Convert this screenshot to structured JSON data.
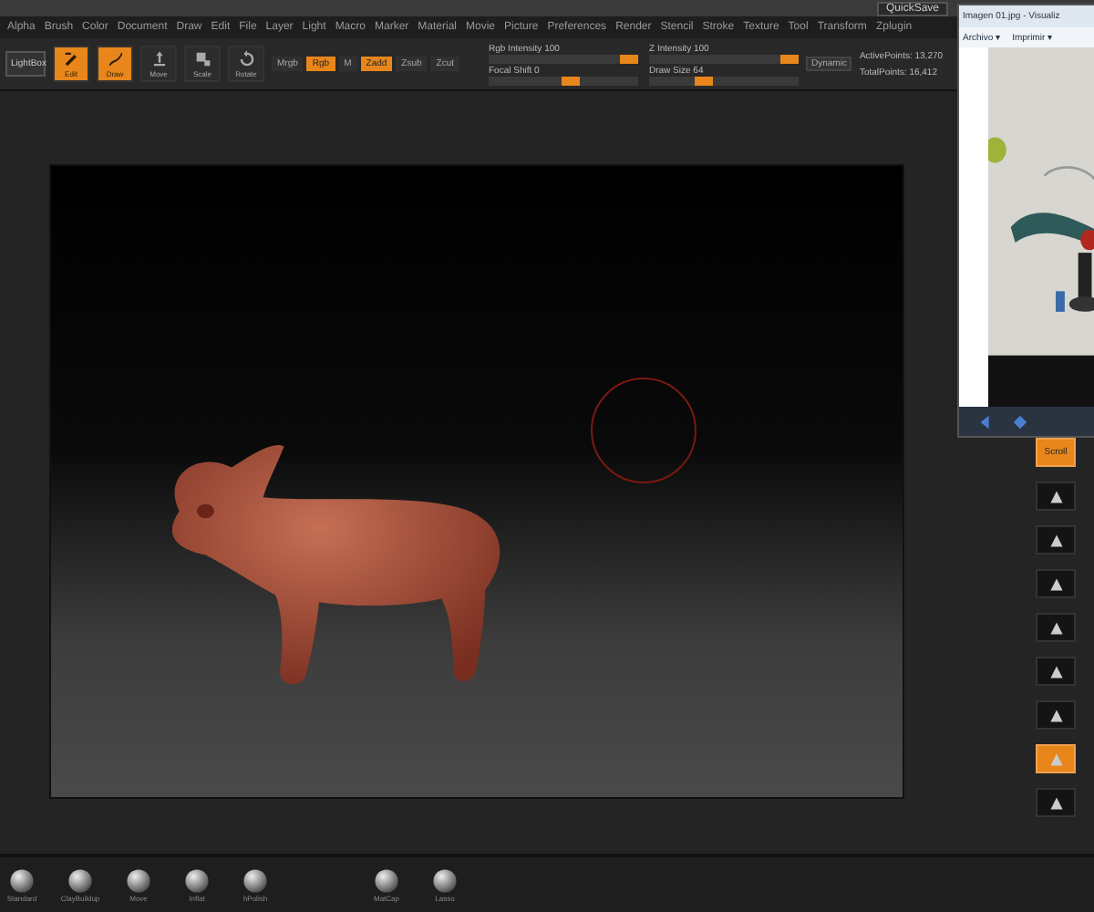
{
  "menu": [
    "Alpha",
    "Brush",
    "Color",
    "Document",
    "Draw",
    "Edit",
    "File",
    "Layer",
    "Light",
    "Macro",
    "Marker",
    "Material",
    "Movie",
    "Picture",
    "Preferences",
    "Render",
    "Stencil",
    "Stroke",
    "Texture",
    "Tool",
    "Transform",
    "Zplugin"
  ],
  "quicksave": "QuickSave",
  "toolbar": {
    "lightbox": "LightBox",
    "tools": [
      {
        "kind": "edit",
        "label": "Edit",
        "selected": true
      },
      {
        "kind": "draw",
        "label": "Draw",
        "selected": true
      },
      {
        "kind": "move",
        "label": "Move",
        "selected": false
      },
      {
        "kind": "scale",
        "label": "Scale",
        "selected": false
      },
      {
        "kind": "rotate",
        "label": "Rotate",
        "selected": false
      }
    ],
    "modes": [
      {
        "label": "Mrgb",
        "selected": false
      },
      {
        "label": "Rgb",
        "selected": true
      },
      {
        "label": "M",
        "selected": false
      },
      {
        "label": "Zadd",
        "selected": true
      },
      {
        "label": "Zsub",
        "selected": false
      },
      {
        "label": "Zcut",
        "selected": false
      }
    ],
    "sliders": [
      {
        "label": "Rgb Intensity 100",
        "level": 1
      },
      {
        "label": "Z Intensity 100",
        "level": 1
      },
      {
        "label": "Focal Shift 0",
        "level": 0.55
      },
      {
        "label": "Draw Size 64",
        "level": 0.35
      }
    ],
    "dynamic": "Dynamic",
    "stats": [
      "ActivePoints: 13,270",
      "TotalPoints: 16,412"
    ]
  },
  "viewer": {
    "title": "Imagen 01.jpg - Visualiz",
    "menu": [
      "Archivo ▾",
      "Imprimir ▾"
    ]
  },
  "shelf": [
    {
      "label": "Scroll",
      "selected": true
    },
    {
      "selected": false
    },
    {
      "selected": false
    },
    {
      "selected": false
    },
    {
      "selected": false
    },
    {
      "selected": false
    },
    {
      "selected": false
    },
    {
      "selected": true
    },
    {
      "selected": false
    }
  ],
  "brushes": [
    "Standard",
    "ClayBuildup",
    "Move",
    "Inflat",
    "hPolish",
    "MatCap",
    "Lasso"
  ]
}
